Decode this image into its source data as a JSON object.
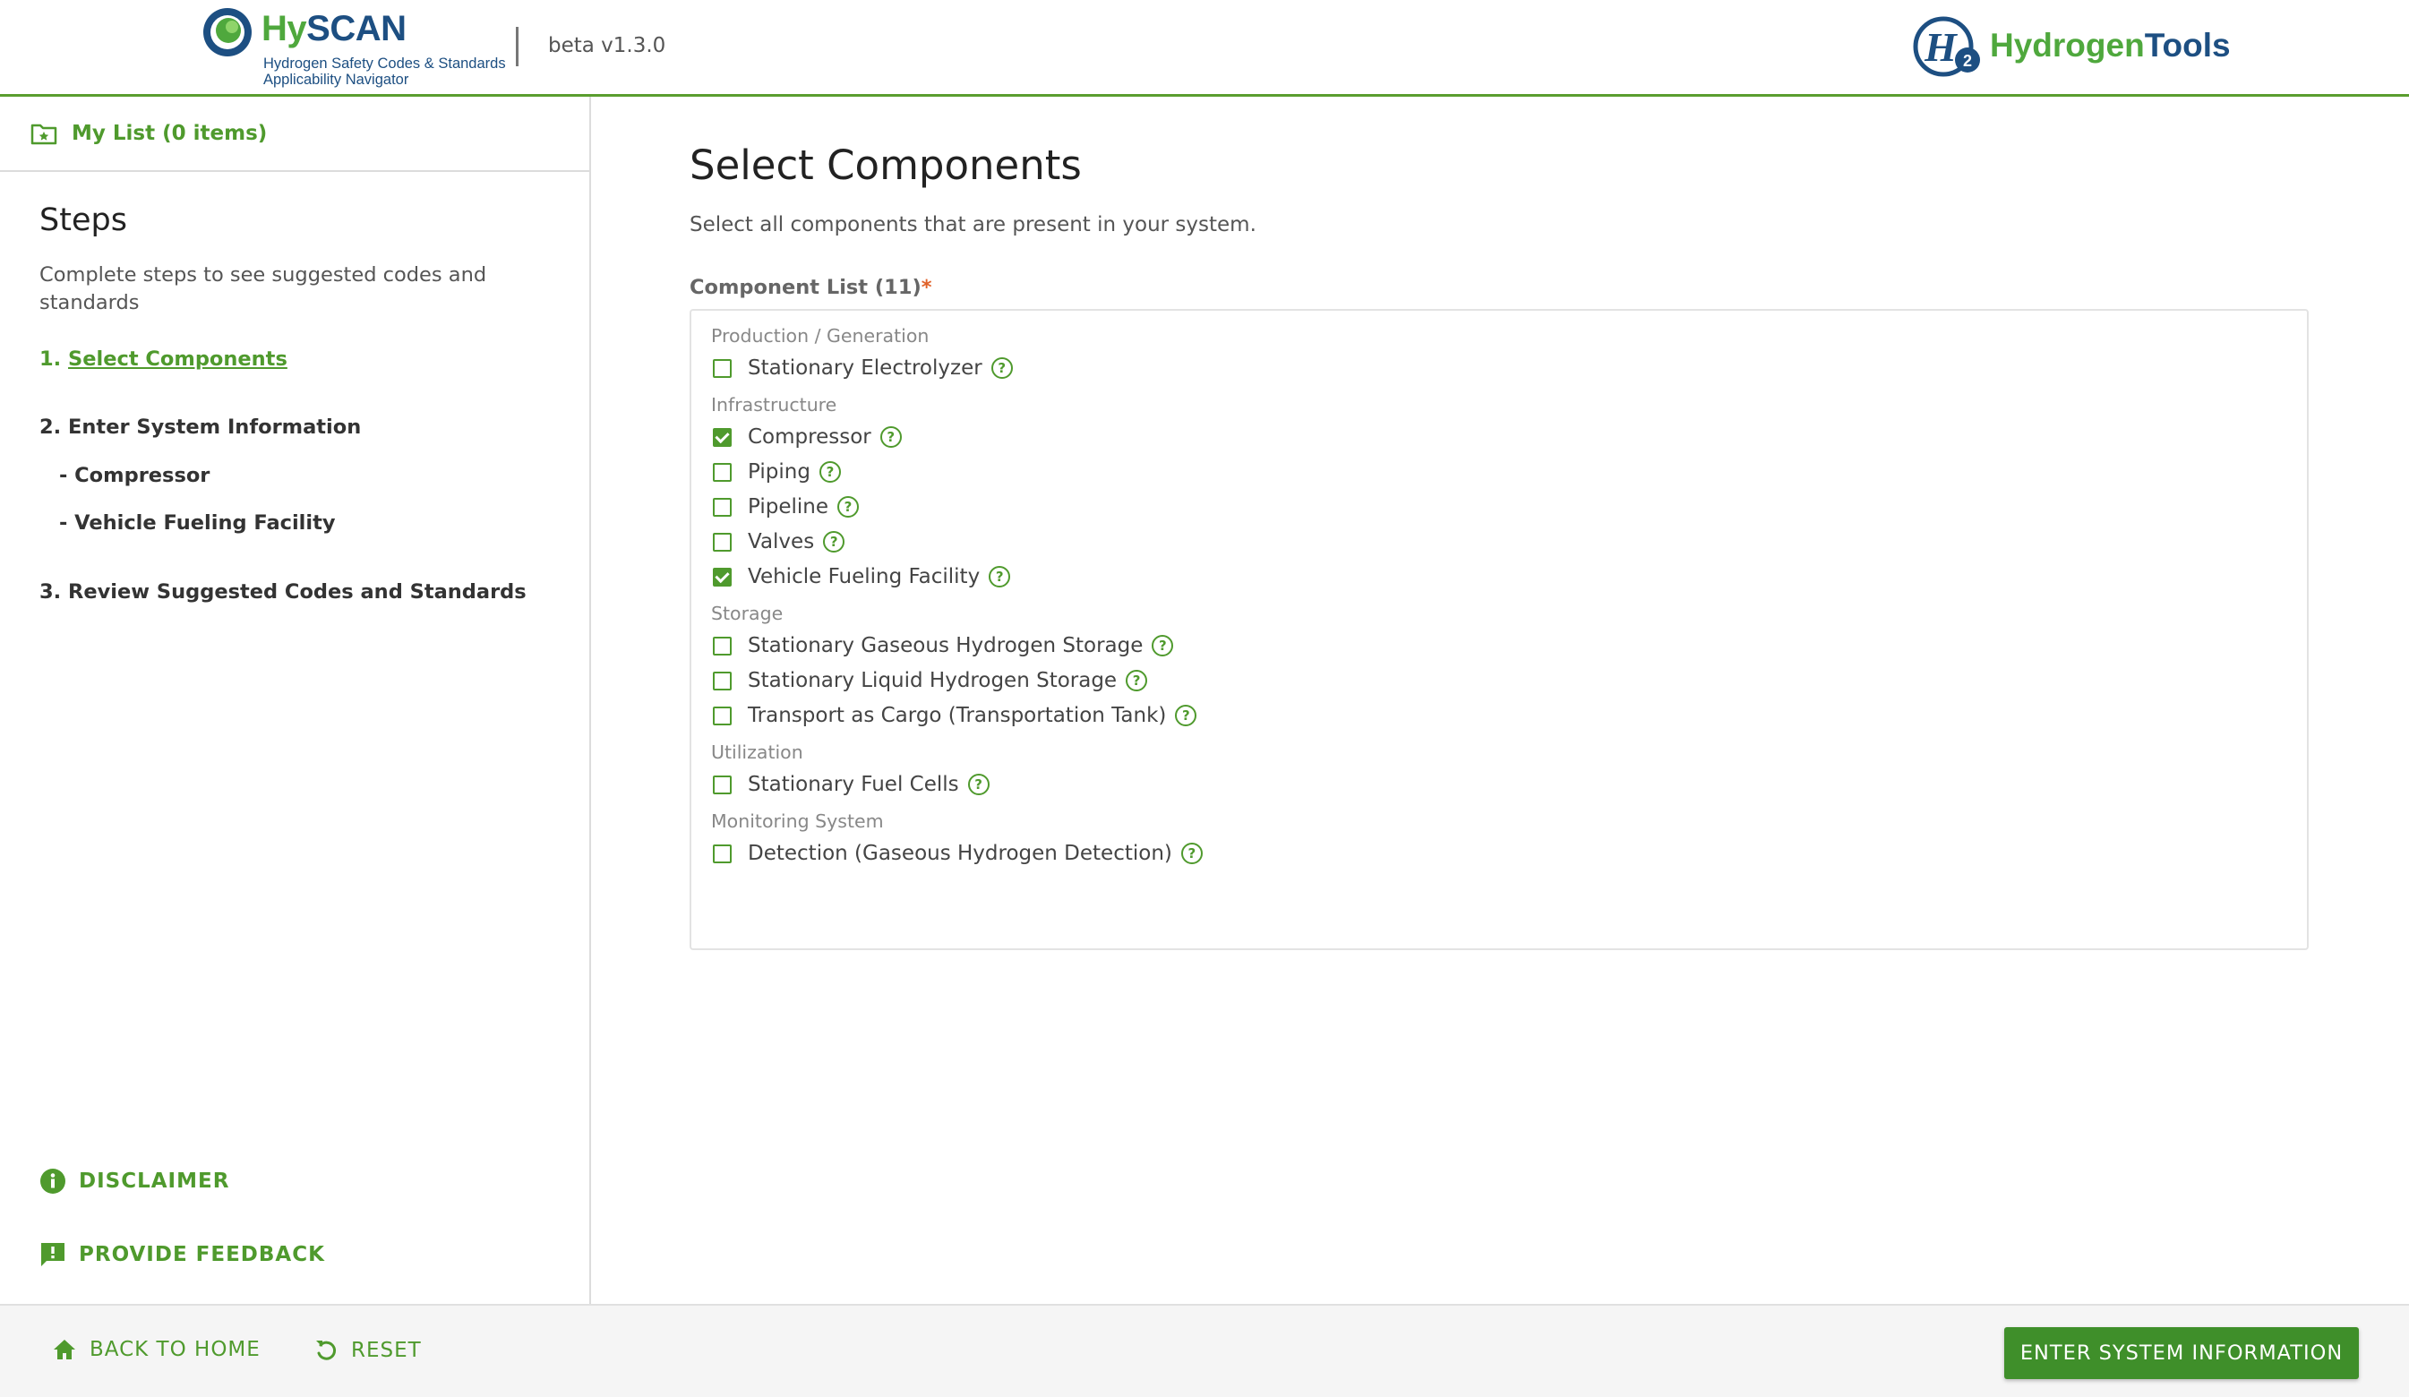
{
  "header": {
    "logo_hy": "Hy",
    "logo_scan": "SCAN",
    "logo_sub_1": "Hydrogen Safety Codes & Standards",
    "logo_sub_2": "Applicability Navigator",
    "version": "beta v1.3.0",
    "partner_a": "Hydrogen",
    "partner_b": "Tools",
    "partner_badge_letter": "H",
    "partner_badge_sub": "2"
  },
  "sidebar": {
    "my_list": "My List (0 items)",
    "steps_title": "Steps",
    "steps_desc": "Complete steps to see suggested codes and standards",
    "steps": [
      {
        "num": "1.",
        "label": "Select Components",
        "active": true
      },
      {
        "num": "2.",
        "label": "Enter System Information",
        "active": false
      },
      {
        "label": "- Compressor"
      },
      {
        "label": "- Vehicle Fueling Facility"
      },
      {
        "num": "3.",
        "label": "Review Suggested Codes and Standards",
        "active": false
      }
    ],
    "disclaimer": "DISCLAIMER",
    "feedback": "PROVIDE FEEDBACK"
  },
  "main": {
    "title": "Select Components",
    "description": "Select all components that are present in your system.",
    "list_label": "Component List (11)",
    "required_mark": "*",
    "groups": [
      {
        "name": "Production / Generation",
        "items": [
          {
            "label": "Stationary Electrolyzer",
            "checked": false
          }
        ]
      },
      {
        "name": "Infrastructure",
        "items": [
          {
            "label": "Compressor",
            "checked": true
          },
          {
            "label": "Piping",
            "checked": false
          },
          {
            "label": "Pipeline",
            "checked": false
          },
          {
            "label": "Valves",
            "checked": false
          },
          {
            "label": "Vehicle Fueling Facility",
            "checked": true
          }
        ]
      },
      {
        "name": "Storage",
        "items": [
          {
            "label": "Stationary Gaseous Hydrogen Storage",
            "checked": false
          },
          {
            "label": "Stationary Liquid Hydrogen Storage",
            "checked": false
          },
          {
            "label": "Transport as Cargo (Transportation Tank)",
            "checked": false
          }
        ]
      },
      {
        "name": "Utilization",
        "items": [
          {
            "label": "Stationary Fuel Cells",
            "checked": false
          }
        ]
      },
      {
        "name": "Monitoring System",
        "items": [
          {
            "label": "Detection (Gaseous Hydrogen Detection)",
            "checked": false
          }
        ]
      }
    ]
  },
  "footer": {
    "back_home": "BACK TO HOME",
    "reset": "RESET",
    "primary": "ENTER SYSTEM INFORMATION"
  },
  "colors": {
    "accent": "#4f9a2d",
    "primary_button": "#3f8f2a",
    "brand_blue": "#1d4f82",
    "required": "#e0622a"
  },
  "icons": {
    "my_list": "folder-star-icon",
    "disclaimer": "info-icon",
    "feedback": "feedback-icon",
    "back_home": "home-icon",
    "reset": "reset-icon",
    "help": "help-circle-icon"
  }
}
